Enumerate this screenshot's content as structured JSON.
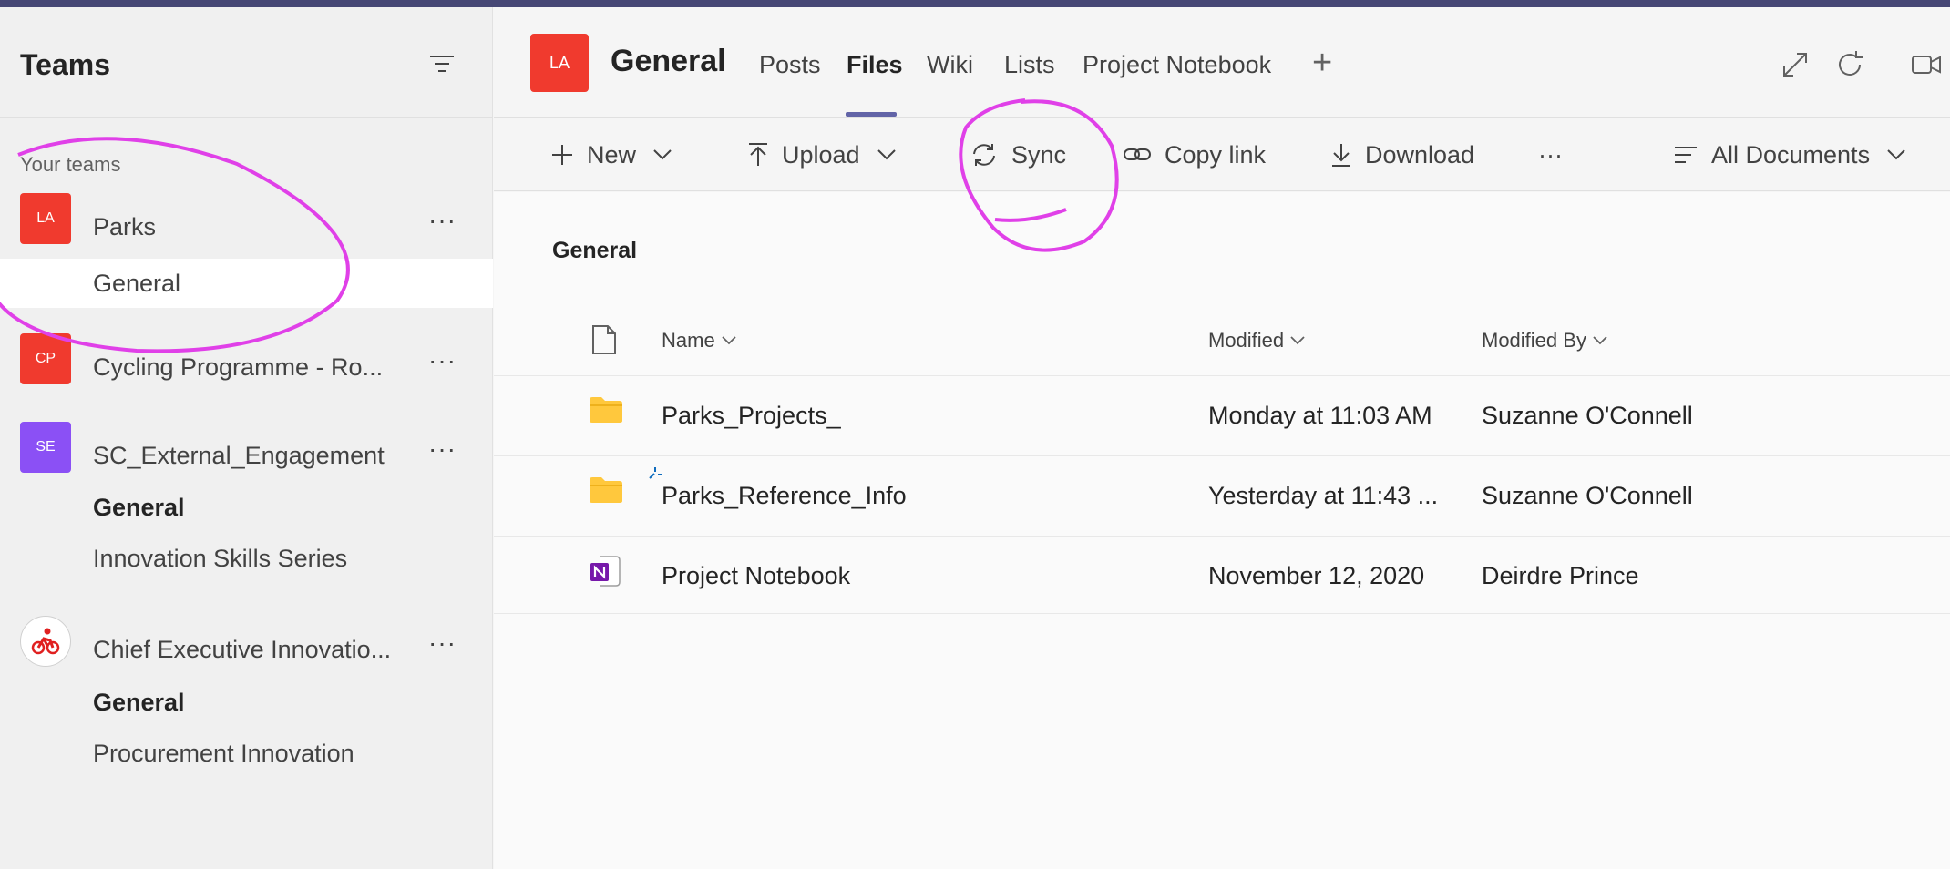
{
  "sidebar": {
    "title": "Teams",
    "section_label": "Your teams",
    "teams": [
      {
        "initials": "LA",
        "name": "Parks",
        "color": "#f03a2e",
        "more": "···"
      },
      {
        "initials": "CP",
        "name": "Cycling Programme - Ro...",
        "color": "#f03a2e",
        "more": "···"
      },
      {
        "initials": "SE",
        "name": "SC_External_Engagement",
        "color": "#8b50f5",
        "more": "···"
      },
      {
        "initials": "",
        "name": "Chief Executive Innovatio...",
        "color": "#ffffff",
        "more": "···"
      }
    ],
    "channels": {
      "parks_general": "General",
      "sc_general": "General",
      "sc_innovation": "Innovation Skills Series",
      "ce_general": "General",
      "ce_procurement": "Procurement Innovation"
    }
  },
  "header": {
    "avatar_initials": "LA",
    "channel_name": "General",
    "tabs": [
      "Posts",
      "Files",
      "Wiki",
      "Lists",
      "Project Notebook"
    ],
    "active_tab": "Files"
  },
  "toolbar": {
    "new": "New",
    "upload": "Upload",
    "sync": "Sync",
    "copy_link": "Copy link",
    "download": "Download",
    "more": "···",
    "view": "All Documents"
  },
  "files": {
    "breadcrumb": "General",
    "columns": {
      "name": "Name",
      "modified": "Modified",
      "modified_by": "Modified By"
    },
    "rows": [
      {
        "type": "folder",
        "name": "Parks_Projects_",
        "modified": "Monday at 11:03 AM",
        "modified_by": "Suzanne O'Connell"
      },
      {
        "type": "folder",
        "name": "Parks_Reference_Info",
        "modified": "Yesterday at 11:43 ...",
        "modified_by": "Suzanne O'Connell"
      },
      {
        "type": "onenote",
        "name": "Project Notebook",
        "modified": "November 12, 2020",
        "modified_by": "Deirdre Prince"
      }
    ]
  },
  "colors": {
    "accent": "#6264a7",
    "annotation": "#e040e8",
    "folder": "#ffc83d",
    "onenote": "#7719aa"
  }
}
